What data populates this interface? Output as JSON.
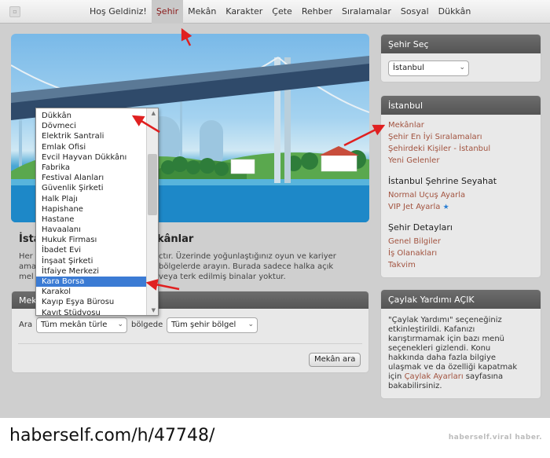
{
  "nav": {
    "items": [
      "Hoş Geldiniz!",
      "Şehir",
      "Mekân",
      "Karakter",
      "Çete",
      "Rehber",
      "Sıralamalar",
      "Sosyal",
      "Dükkân"
    ],
    "active_index": 1
  },
  "main": {
    "title_left": "İsta",
    "title_right": "kânlar",
    "desc": {
      "l1_left": "Her",
      "l1_right": "ctır. Üzerinde yoğunlaştığınız oyun ve kariyer",
      "l2_left": "ama",
      "l2_right": "bölgelerde arayın. Burada sadece halka açık",
      "l3_left": "mel",
      "l3_right": "veya terk edilmiş binalar yoktur."
    }
  },
  "search": {
    "header": "Mek",
    "label_ara": "Ara",
    "type_select": "Tüm mekân türle",
    "label_bolgede": "bölgede",
    "region_select": "Tüm şehir bölgel",
    "button": "Mekân ara"
  },
  "dropdown": {
    "options": [
      "Dükkân",
      "Dövmeci",
      "Elektrik Santrali",
      "Emlak Ofisi",
      "Evcil Hayvan Dükkânı",
      "Fabrika",
      "Festival Alanları",
      "Güvenlik Şirketi",
      "Halk Plajı",
      "Hapishane",
      "Hastane",
      "Havaalanı",
      "Hukuk Firması",
      "İbadet Evi",
      "İnşaat Şirketi",
      "İtfaiye Merkezi",
      "Kara Borsa",
      "Karakol",
      "Kayıp Eşya Bürosu",
      "Kayıt Stüdyosu"
    ],
    "selected_index": 16
  },
  "city_select": {
    "header": "Şehir Seç",
    "value": "İstanbul"
  },
  "istanbul": {
    "header": "İstanbul",
    "links": [
      "Mekânlar",
      "Şehir En İyi Sıralamaları",
      "Şehirdeki Kişiler - İstanbul",
      "Yeni Gelenler"
    ],
    "travel_title": "İstanbul Şehrine Seyahat",
    "travel_links": [
      "Normal Uçuş Ayarla",
      "VIP Jet Ayarla"
    ],
    "details_title": "Şehir Detayları",
    "detail_links": [
      "Genel Bilgiler",
      "İş Olanakları",
      "Takvim"
    ]
  },
  "help": {
    "header": "Çaylak Yardımı AÇIK",
    "lines": [
      "\"Çaylak Yardımı\" seçeneğiniz",
      "etkinleştirildi. Kafanızı",
      "karıştırmamak için bazı menü",
      "seçenekleri gizlendi. Konu",
      "hakkında daha fazla bilgiye",
      "ulaşmak ve da özelliği kapatmak"
    ],
    "last_prefix": "için ",
    "last_link": "Çaylak Ayarları",
    "last_suffix": " sayfasına",
    "final_line": "bakabilirsiniz."
  },
  "footer": {
    "url": "haberself.com/h/47748/",
    "brand": "haberself.viral haber."
  },
  "colors": {
    "link": "#a2533f",
    "selected": "#3b7bd4",
    "arrow": "#e02020"
  }
}
